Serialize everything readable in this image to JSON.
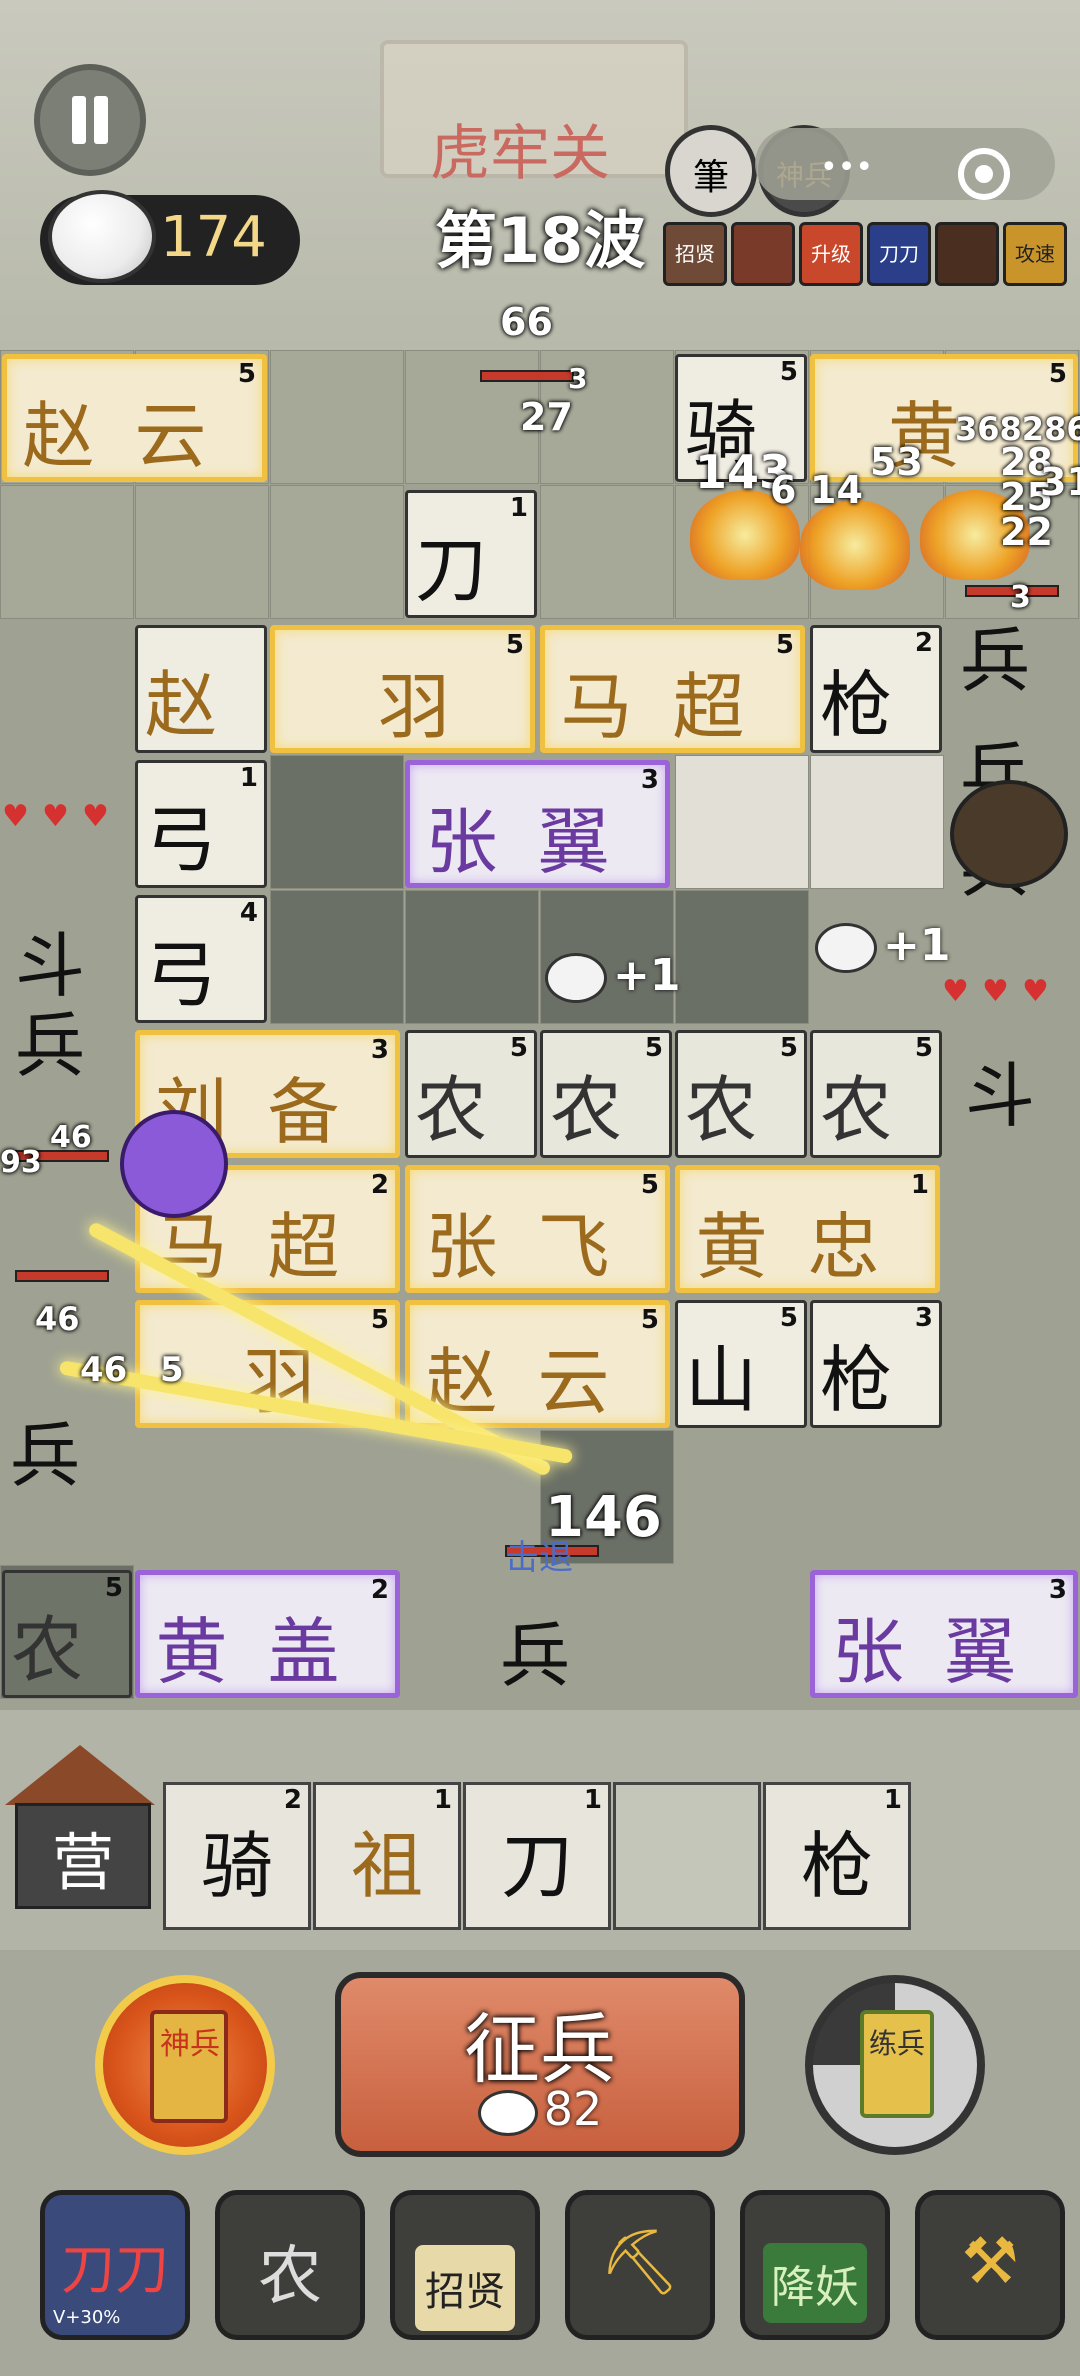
{
  "header": {
    "pass_name": "虎牢关",
    "coins": "174",
    "wave": "第18波",
    "skills": [
      "筆",
      "神兵"
    ],
    "buffs": [
      "招贤",
      "",
      "升级",
      "刀刀",
      "",
      "攻速"
    ]
  },
  "board": {
    "tiles": [
      {
        "name": "赵云",
        "level": "5",
        "style": "gold"
      },
      {
        "name": "骑",
        "level": "5",
        "style": "plain"
      },
      {
        "name": "黄",
        "level": "5",
        "style": "gold"
      },
      {
        "name": "刀",
        "level": "1",
        "style": "plain"
      },
      {
        "name": "赵",
        "level": "",
        "style": "plain"
      },
      {
        "name": "羽",
        "level": "5",
        "style": "gold"
      },
      {
        "name": "马超",
        "level": "5",
        "style": "gold"
      },
      {
        "name": "枪",
        "level": "2",
        "style": "plain"
      },
      {
        "name": "弓",
        "level": "1",
        "style": "plain"
      },
      {
        "name": "张翼",
        "level": "3",
        "style": "purple"
      },
      {
        "name": "弓",
        "level": "4",
        "style": "plain"
      },
      {
        "name": "刘备",
        "level": "3",
        "style": "gold"
      },
      {
        "name": "农",
        "level": "5",
        "style": "green"
      },
      {
        "name": "农",
        "level": "5",
        "style": "green"
      },
      {
        "name": "农",
        "level": "5",
        "style": "green"
      },
      {
        "name": "农",
        "level": "5",
        "style": "green"
      },
      {
        "name": "马超",
        "level": "2",
        "style": "gold"
      },
      {
        "name": "张飞",
        "level": "5",
        "style": "gold"
      },
      {
        "name": "黄忠",
        "level": "1",
        "style": "gold"
      },
      {
        "name": "羽",
        "level": "5",
        "style": "gold"
      },
      {
        "name": "赵云",
        "level": "5",
        "style": "gold"
      },
      {
        "name": "山",
        "level": "5",
        "style": "plain"
      },
      {
        "name": "枪",
        "level": "3",
        "style": "plain"
      },
      {
        "name": "黄盖",
        "level": "2",
        "style": "purple"
      },
      {
        "name": "张翼",
        "level": "3",
        "style": "purple"
      },
      {
        "name": "农",
        "level": "5",
        "style": "green"
      }
    ],
    "enemies": [
      "兵",
      "兵",
      "兵",
      "斗",
      "兵",
      "斗",
      "兵",
      "兵"
    ],
    "damage_numbers": [
      "66",
      "3",
      "27",
      "368286",
      "143",
      "6",
      "14",
      "53",
      "28",
      "25",
      "31",
      "22",
      "3",
      "46",
      "93",
      "46",
      "46",
      "5",
      "146"
    ],
    "coin_pops": [
      "+1",
      "+1"
    ],
    "status_text": "击退"
  },
  "bench": {
    "camp_label": "营",
    "slots": [
      {
        "name": "骑",
        "level": "2"
      },
      {
        "name": "祖",
        "level": "1"
      },
      {
        "name": "刀",
        "level": "1"
      },
      {
        "name": "",
        "level": ""
      },
      {
        "name": "枪",
        "level": "1"
      }
    ]
  },
  "actions": {
    "god_card": "神兵",
    "recruit_label": "征兵",
    "recruit_cost": "82",
    "train_card": "练兵"
  },
  "tools": [
    "刀刀",
    "农",
    "招贤",
    "",
    "降妖",
    ""
  ],
  "tool_sub": "V+30%",
  "colors": {
    "gold_border": "#f0c040",
    "purple_border": "#9a63d8",
    "recruit": "#c8603e",
    "hp": "#c53a2a"
  }
}
